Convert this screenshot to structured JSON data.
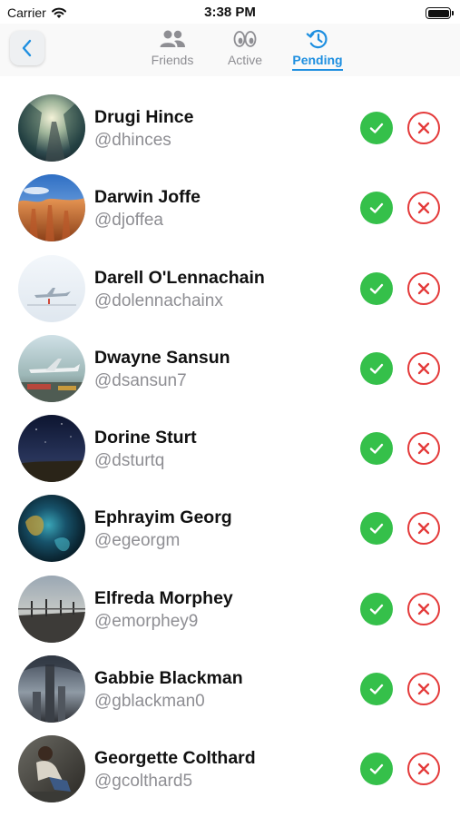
{
  "status_bar": {
    "carrier": "Carrier",
    "time": "3:38 PM"
  },
  "nav": {
    "back_icon": "chevron-left-icon",
    "tabs": [
      {
        "label": "Friends",
        "icon": "people-icon",
        "active": false
      },
      {
        "label": "Active",
        "icon": "eyes-icon",
        "active": false
      },
      {
        "label": "Pending",
        "icon": "history-icon",
        "active": true
      }
    ]
  },
  "colors": {
    "accent": "#1e8fe0",
    "accept": "#35c04a",
    "reject": "#e43a3a",
    "secondary_text": "#8e8e93"
  },
  "requests": [
    {
      "name": "Drugi Hince",
      "handle": "@dhinces",
      "avatar": "forest-road-photo"
    },
    {
      "name": "Darwin Joffe",
      "handle": "@djoffea",
      "avatar": "canyon-hoodoos-photo"
    },
    {
      "name": "Darell O'Lennachain",
      "handle": "@dolennachainx",
      "avatar": "snowy-plane-photo"
    },
    {
      "name": "Dwayne Sansun",
      "handle": "@dsansun7",
      "avatar": "airport-plane-photo"
    },
    {
      "name": "Dorine Sturt",
      "handle": "@dsturtq",
      "avatar": "night-sky-photo"
    },
    {
      "name": "Ephrayim Georg",
      "handle": "@egeorgm",
      "avatar": "teal-gold-abstract-photo"
    },
    {
      "name": "Elfreda Morphey",
      "handle": "@emorphey9",
      "avatar": "pier-sunset-photo"
    },
    {
      "name": "Gabbie Blackman",
      "handle": "@gblackman0",
      "avatar": "city-tower-photo"
    },
    {
      "name": "Georgette Colthard",
      "handle": "@gcolthard5",
      "avatar": "person-sitting-photo"
    }
  ]
}
